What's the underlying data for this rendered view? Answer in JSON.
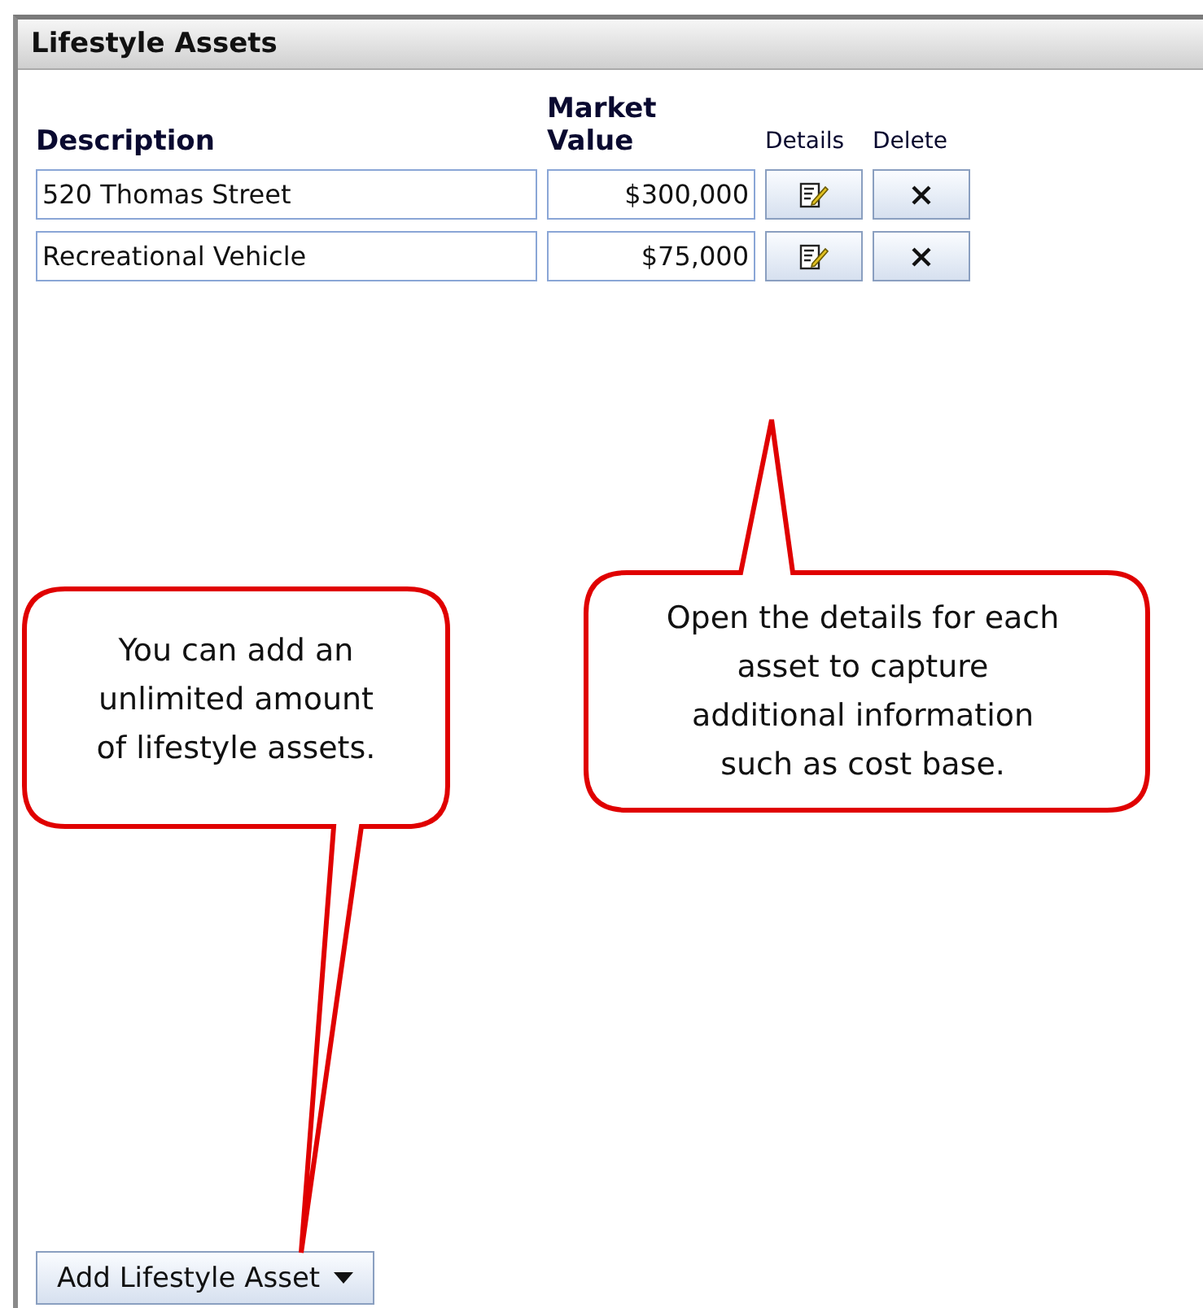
{
  "panel": {
    "title": "Lifestyle Assets"
  },
  "columns": [
    "Description",
    "Market Value",
    "Details",
    "Delete"
  ],
  "rows": [
    {
      "description": "520 Thomas Street",
      "market_value": "$300,000"
    },
    {
      "description": "Recreational Vehicle",
      "market_value": "$75,000"
    }
  ],
  "add_button": {
    "label": "Add Lifestyle Asset"
  },
  "callouts": [
    {
      "kind": "tail-down",
      "text": "You can add an\nunlimited amount\nof lifestyle assets."
    },
    {
      "kind": "tail-up",
      "text": "Open the details for each\nasset to capture\nadditional information\nsuch as cost base."
    }
  ]
}
